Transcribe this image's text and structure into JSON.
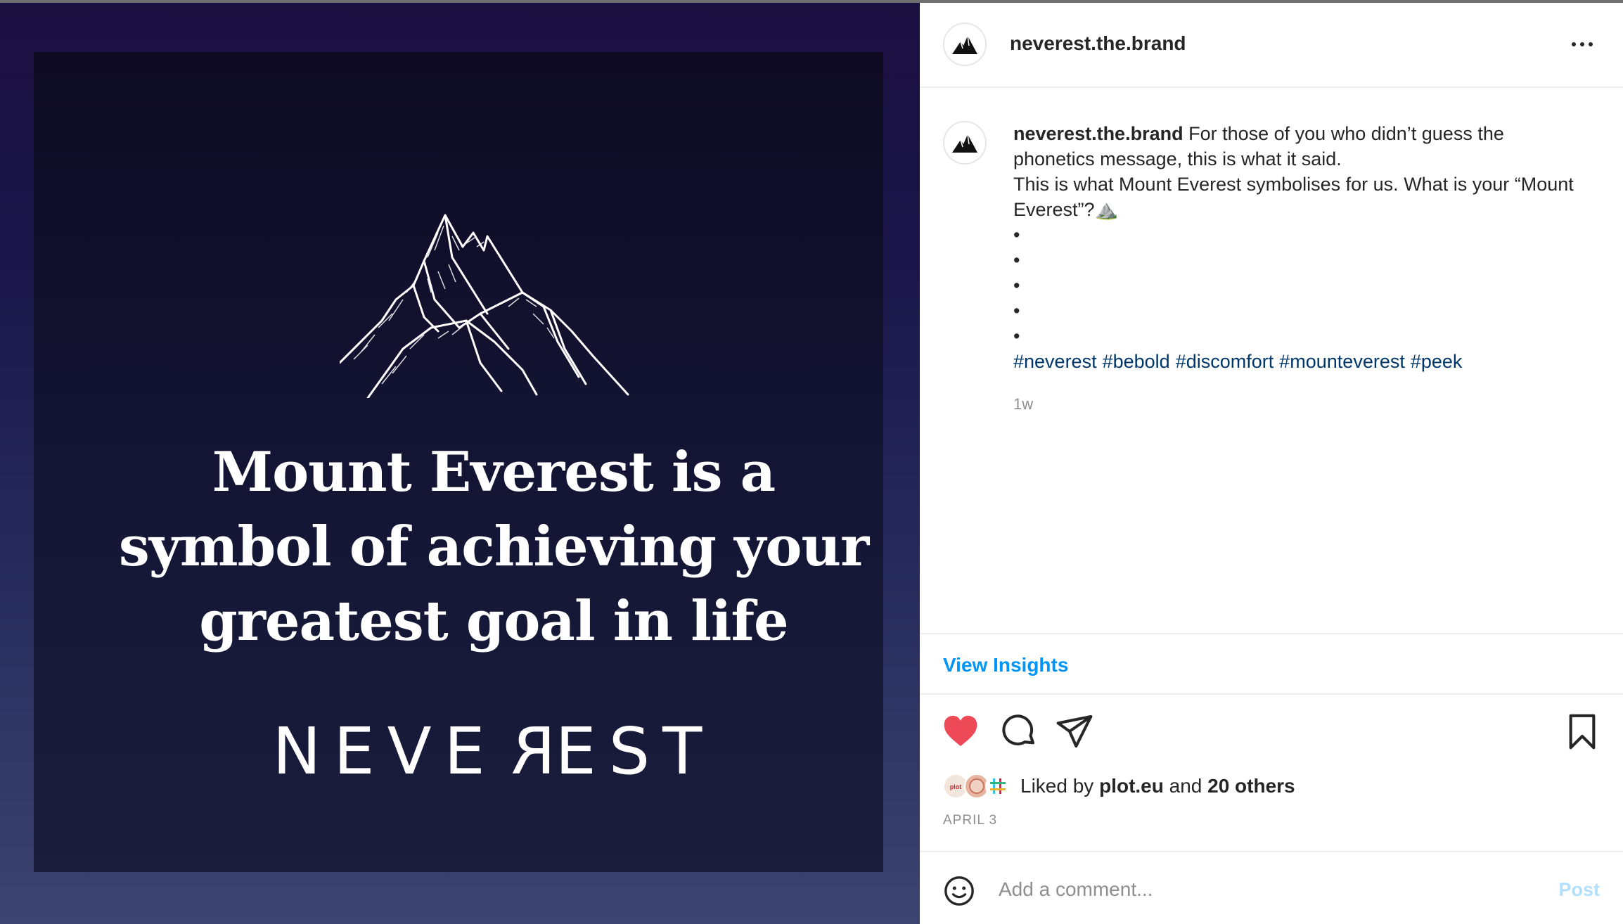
{
  "post": {
    "headline": "Mount Everest is a symbol of achieving your greatest goal in life",
    "brand_logo": {
      "before": "NEVE",
      "reversed": "R",
      "after": "EST"
    }
  },
  "header": {
    "username": "neverest.the.brand"
  },
  "caption": {
    "username": "neverest.the.brand",
    "line1": "For those of you who didn’t guess the phonetics message, this is what it said.",
    "line2": "This is what Mount Everest symbolises for us. What is your “Mount Everest”?⛰️",
    "bullets": [
      "•",
      "•",
      "•",
      "•",
      "•"
    ],
    "hashtags": [
      "#neverest",
      "#bebold",
      "#discomfort",
      "#mounteverest",
      "#peek"
    ],
    "time_ago": "1w"
  },
  "insights": {
    "label": "View Insights"
  },
  "likes": {
    "prefix": "Liked by",
    "user": "plot.eu",
    "joiner": "and",
    "others": "20 others"
  },
  "date": "APRIL 3",
  "comment": {
    "placeholder": "Add a comment...",
    "post_label": "Post"
  },
  "colors": {
    "like_red": "#ed4956",
    "link_blue": "#0095f6",
    "hashtag_blue": "#00376b",
    "post_disabled": "#b2dffc"
  },
  "icons": [
    "more-icon",
    "heart-icon",
    "comment-icon",
    "share-icon",
    "bookmark-icon",
    "emoji-icon",
    "brand-mountain-icon"
  ]
}
